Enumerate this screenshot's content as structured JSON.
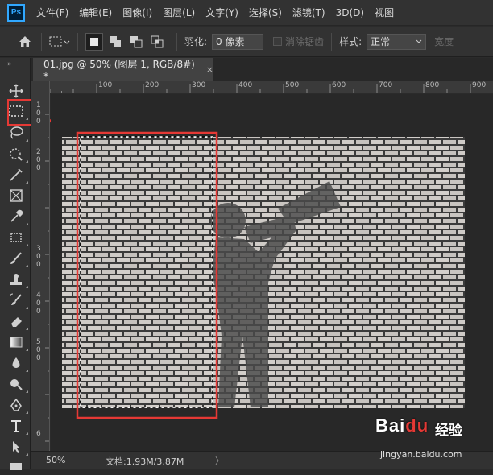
{
  "app": {
    "logo_text": "Ps"
  },
  "menu": {
    "items": [
      "文件(F)",
      "编辑(E)",
      "图像(I)",
      "图层(L)",
      "文字(Y)",
      "选择(S)",
      "滤镜(T)",
      "3D(D)",
      "视图"
    ]
  },
  "options": {
    "feather_label": "羽化:",
    "feather_value": "0 像素",
    "antialias_label": "消除锯齿",
    "style_label": "样式:",
    "style_value": "正常",
    "width_label": "宽度"
  },
  "document": {
    "tab_title": "01.jpg @ 50% (图层 1, RGB/8#) *",
    "close_glyph": "×"
  },
  "ruler": {
    "h_ticks": [
      "100",
      "200",
      "300",
      "400",
      "500",
      "600",
      "700",
      "800",
      "900"
    ],
    "v_ticks": [
      "1",
      "0",
      "0",
      "2",
      "0",
      "0",
      "3",
      "0",
      "0",
      "4",
      "0",
      "0",
      "5",
      "0",
      "0",
      "6"
    ]
  },
  "status": {
    "zoom": "50%",
    "doc_size": "文档:1.93M/3.87M",
    "arrow": "〉"
  },
  "watermark": {
    "brand_bai": "Bai",
    "brand_du": "du",
    "brand_cn": "经验",
    "url": "jingyan.baidu.com"
  },
  "colors": {
    "highlight": "#e53935",
    "panel": "#323232",
    "canvas_bg": "#282828"
  }
}
